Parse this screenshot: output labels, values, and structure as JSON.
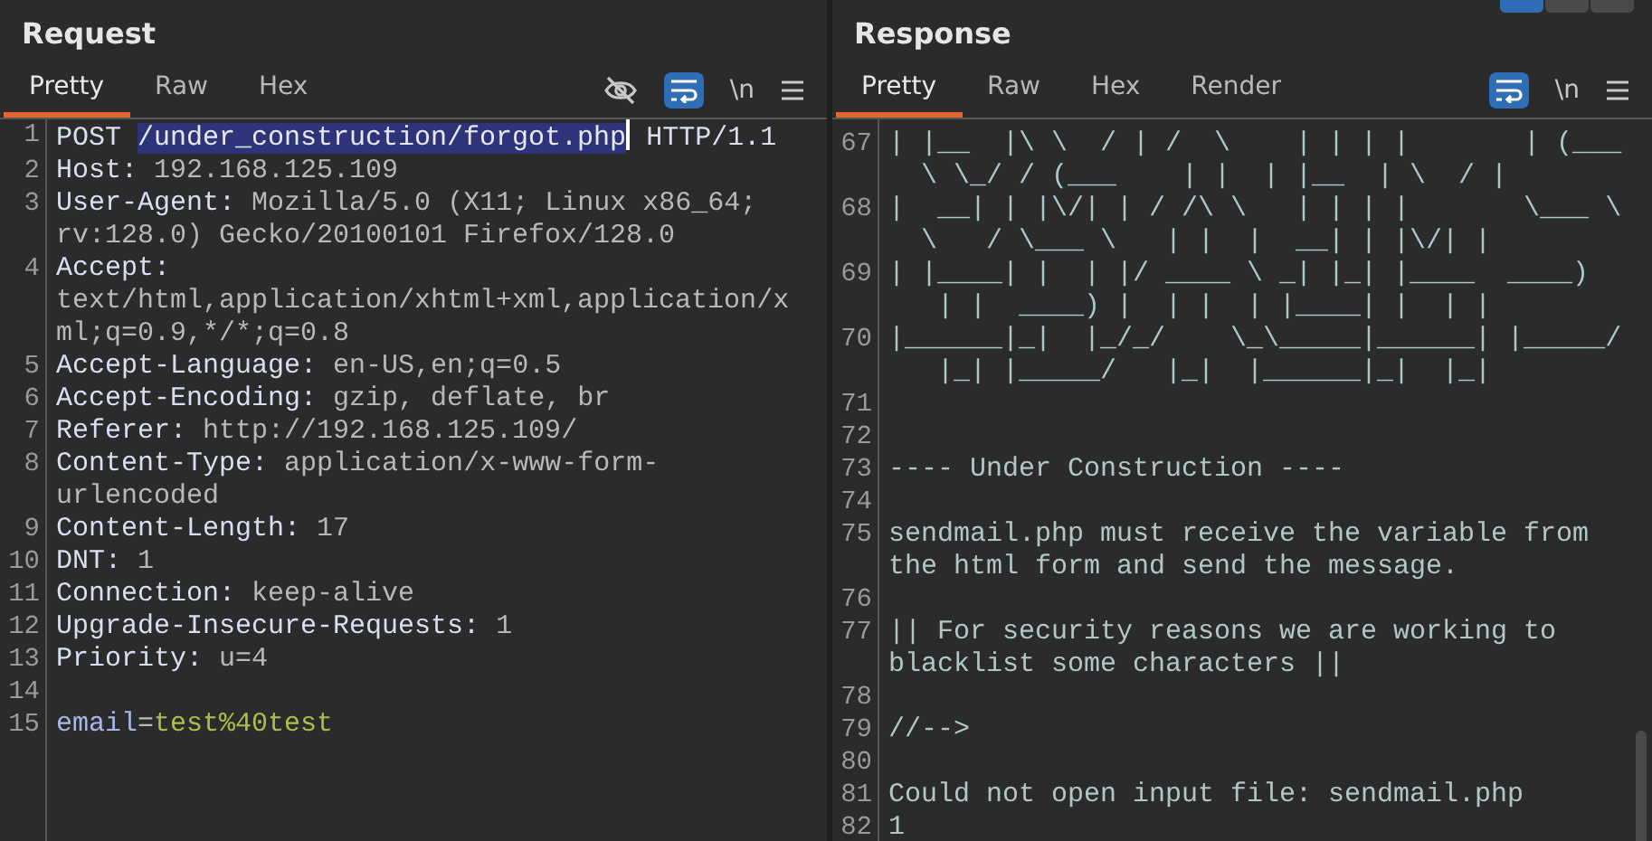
{
  "layout_buttons": [
    {
      "selected": true
    },
    {
      "selected": false
    },
    {
      "selected": false
    }
  ],
  "request": {
    "title": "Request",
    "tabs": [
      {
        "label": "Pretty",
        "selected": true
      },
      {
        "label": "Raw",
        "selected": false
      },
      {
        "label": "Hex",
        "selected": false
      }
    ],
    "toolbar": {
      "hide_icon": true,
      "wrap_on": true,
      "newline_label": "\\n"
    },
    "lines": [
      {
        "kind": "request_line",
        "number": "1",
        "method": "POST",
        "path": "/under_construction/forgot.php",
        "path_selected": true,
        "version": "HTTP/1.1"
      },
      {
        "kind": "header",
        "number": "2",
        "name": "Host:",
        "value": "192.168.125.109"
      },
      {
        "kind": "header",
        "number": "3",
        "name": "User-Agent:",
        "value": "Mozilla/5.0 (X11; Linux x86_64; rv:128.0) Gecko/20100101 Firefox/128.0"
      },
      {
        "kind": "header",
        "number": "4",
        "name": "Accept:",
        "value": "text/html,application/xhtml+xml,application/xml;q=0.9,*/*;q=0.8"
      },
      {
        "kind": "header",
        "number": "5",
        "name": "Accept-Language:",
        "value": "en-US,en;q=0.5"
      },
      {
        "kind": "header",
        "number": "6",
        "name": "Accept-Encoding:",
        "value": "gzip, deflate, br"
      },
      {
        "kind": "header",
        "number": "7",
        "name": "Referer:",
        "value": "http://192.168.125.109/"
      },
      {
        "kind": "header",
        "number": "8",
        "name": "Content-Type:",
        "value": "application/x-www-form-urlencoded"
      },
      {
        "kind": "header",
        "number": "9",
        "name": "Content-Length:",
        "value": "17"
      },
      {
        "kind": "header",
        "number": "10",
        "name": "DNT:",
        "value": "1"
      },
      {
        "kind": "header",
        "number": "11",
        "name": "Connection:",
        "value": "keep-alive"
      },
      {
        "kind": "header",
        "number": "12",
        "name": "Upgrade-Insecure-Requests:",
        "value": "1"
      },
      {
        "kind": "header",
        "number": "13",
        "name": "Priority:",
        "value": "u=4"
      },
      {
        "kind": "blank",
        "number": "14"
      },
      {
        "kind": "body",
        "number": "15",
        "name": "email",
        "separator": "=",
        "value": "test%40test"
      }
    ]
  },
  "response": {
    "title": "Response",
    "tabs": [
      {
        "label": "Pretty",
        "selected": true
      },
      {
        "label": "Raw",
        "selected": false
      },
      {
        "label": "Hex",
        "selected": false
      },
      {
        "label": "Render",
        "selected": false
      }
    ],
    "toolbar": {
      "wrap_on": true,
      "newline_label": "\\n"
    },
    "lines": [
      {
        "kind": "art",
        "number": "67",
        "rows": [
          "| |__  |\\ \\  / | /  \\    | | | |       | (___",
          "  \\ \\_/ / (___    | |  | |__  | \\  / |"
        ]
      },
      {
        "kind": "art",
        "number": "68",
        "rows": [
          "|  __| | |\\/| | / /\\ \\   | | | |       \\___ \\",
          "  \\   / \\___ \\   | |  |  __| | |\\/| |"
        ]
      },
      {
        "kind": "art",
        "number": "69",
        "rows": [
          "| |____| |  | |/ ____ \\ _| |_| |____  ____)",
          "   | |  ____) |  | |  | |____| |  | |"
        ]
      },
      {
        "kind": "art",
        "number": "70",
        "rows": [
          "|______|_|  |_/_/    \\_\\_____|______| |_____/",
          "   |_| |_____/   |_|  |______|_|  |_|"
        ]
      },
      {
        "kind": "blank",
        "number": "71"
      },
      {
        "kind": "blank",
        "number": "72"
      },
      {
        "kind": "text",
        "number": "73",
        "text": "---- Under Construction ----"
      },
      {
        "kind": "blank",
        "number": "74"
      },
      {
        "kind": "text",
        "number": "75",
        "text": "sendmail.php must receive the variable from the html form and send the message."
      },
      {
        "kind": "blank",
        "number": "76"
      },
      {
        "kind": "text",
        "number": "77",
        "text": "|| For security reasons we are working to blacklist some characters ||"
      },
      {
        "kind": "blank",
        "number": "78"
      },
      {
        "kind": "text",
        "number": "79",
        "text": "//-->"
      },
      {
        "kind": "blank",
        "number": "80"
      },
      {
        "kind": "text",
        "number": "81",
        "text": "Could not open input file: sendmail.php"
      },
      {
        "kind": "text",
        "number": "82",
        "text": "1"
      }
    ]
  }
}
